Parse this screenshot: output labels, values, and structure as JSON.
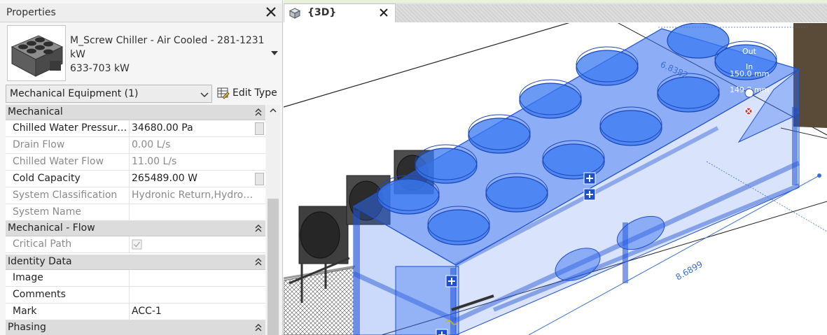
{
  "properties": {
    "title": "Properties",
    "type_name": "M_Screw Chiller - Air Cooled - 281-1231\nkW\n633-703 kW",
    "category": "Mechanical Equipment (1)",
    "edit_type": "Edit Type",
    "groups": [
      {
        "name": "Mechanical",
        "rows": [
          {
            "name": "Chilled Water Pressure ...",
            "value": "34680.00 Pa",
            "disabled": false
          },
          {
            "name": "Drain Flow",
            "value": "0.00 L/s",
            "disabled": true
          },
          {
            "name": "Chilled Water Flow",
            "value": "11.00 L/s",
            "disabled": true
          },
          {
            "name": "Cold Capacity",
            "value": "265489.00 W",
            "disabled": false
          },
          {
            "name": "System Classification",
            "value": "Hydronic Return,Hydronic...",
            "disabled": true
          },
          {
            "name": "System Name",
            "value": "",
            "disabled": true
          }
        ]
      },
      {
        "name": "Mechanical - Flow",
        "rows": [
          {
            "name": "Critical Path",
            "value": "",
            "disabled": true
          }
        ]
      },
      {
        "name": "Identity Data",
        "rows": [
          {
            "name": "Image",
            "value": "",
            "disabled": false
          },
          {
            "name": "Comments",
            "value": "",
            "disabled": false
          },
          {
            "name": "Mark",
            "value": "ACC-1",
            "disabled": false
          }
        ]
      },
      {
        "name": "Phasing",
        "rows": []
      }
    ]
  },
  "view": {
    "tab_label": "{3D}",
    "dimension_top": "6.8382",
    "dimension_bottom": "8.6899",
    "connector_out": "Out",
    "connector_in": "In",
    "connector_size_1": "150.0 mm",
    "connector_size_2": "149.2 mm"
  },
  "colors": {
    "selection_blue": "#2f6bf0",
    "panel_bg": "#f5f5f5",
    "group_header": "#dcdcdc"
  }
}
